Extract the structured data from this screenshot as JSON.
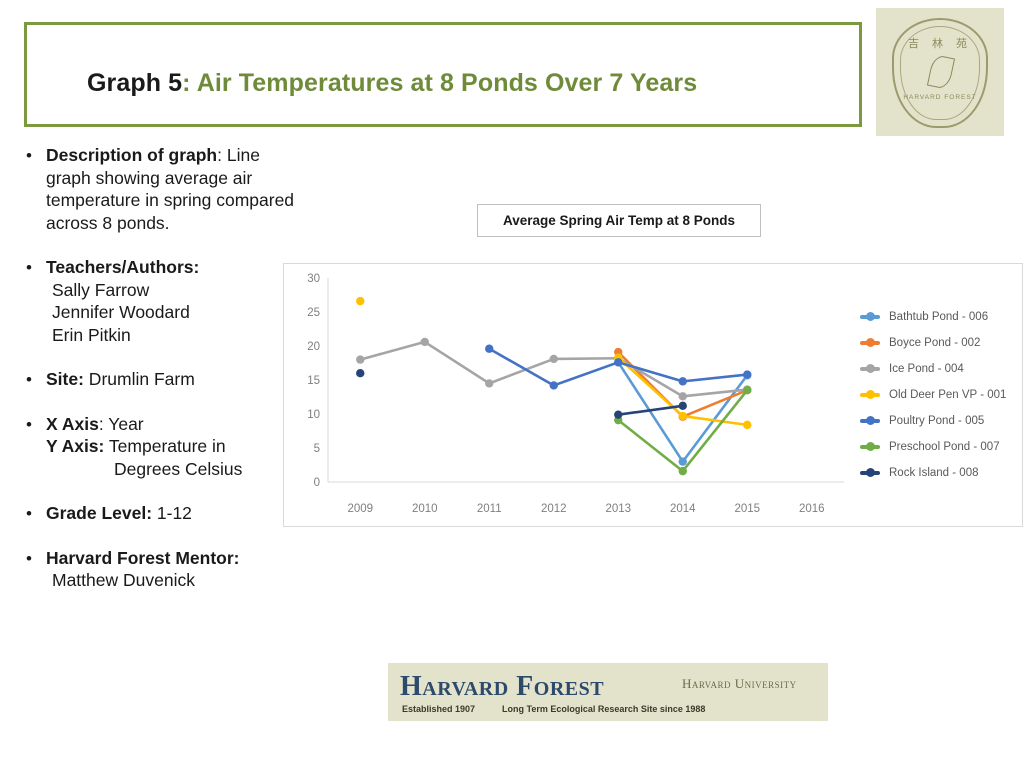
{
  "slide": {
    "title_lead": "Graph 5",
    "title_rest": ": Air Temperatures at 8 Ponds Over 7 Years"
  },
  "seal": {
    "chars": "吉 林 苑",
    "bottom": "HARVARD  FOREST"
  },
  "description": {
    "desc_label": "Description of graph",
    "desc_text": ": Line graph showing average air temperature in spring compared across 8 ponds.",
    "teachers_label": "Teachers/Authors:",
    "teachers": [
      "Sally Farrow",
      "Jennifer Woodard",
      "Erin Pitkin"
    ],
    "site_label": "Site:",
    "site_value": " Drumlin Farm",
    "x_axis_label": "X Axis",
    "x_axis_value": ": Year",
    "y_axis_label": "Y Axis:",
    "y_axis_value": " Temperature  in",
    "y_axis_value2": "Degrees Celsius",
    "grade_label": "Grade Level:",
    "grade_value": "  1-12",
    "mentor_label": "Harvard Forest Mentor:",
    "mentor_value": "Matthew Duvenick"
  },
  "footer": {
    "logo_title": "Harvard Forest",
    "logo_university": "Harvard University",
    "logo_sub_left": "Established 1907",
    "logo_sub_right": "Long Term Ecological Research Site since 1988"
  },
  "chart_data": {
    "type": "line",
    "title": "Average Spring Air Temp at 8 Ponds",
    "xlabel": "",
    "ylabel": "",
    "categories": [
      "2009",
      "2010",
      "2011",
      "2012",
      "2013",
      "2014",
      "2015",
      "2016"
    ],
    "ylim": [
      0,
      30
    ],
    "yticks": [
      0,
      5,
      10,
      15,
      20,
      25,
      30
    ],
    "grid": false,
    "legend_position": "right",
    "series": [
      {
        "name": "Bathtub Pond  - 006",
        "color": "#5b9bd5",
        "values": [
          null,
          null,
          null,
          null,
          17.6,
          3.0,
          15.7,
          null
        ]
      },
      {
        "name": "Boyce Pond - 002",
        "color": "#ed7d31",
        "values": [
          null,
          null,
          null,
          null,
          19.1,
          9.6,
          13.5,
          null
        ]
      },
      {
        "name": "Ice Pond - 004",
        "color": "#a5a5a5",
        "values": [
          18.0,
          20.6,
          14.5,
          18.1,
          18.2,
          12.6,
          13.6,
          null
        ]
      },
      {
        "name": "Old Deer Pen VP - 001",
        "color": "#ffc000",
        "values": [
          26.6,
          null,
          null,
          null,
          18.3,
          9.7,
          8.4,
          null
        ]
      },
      {
        "name": "Poultry Pond - 005",
        "color": "#4472c4",
        "values": [
          null,
          null,
          19.6,
          14.2,
          17.6,
          14.8,
          15.8,
          null
        ]
      },
      {
        "name": "Preschool Pond - 007",
        "color": "#70ad47",
        "values": [
          null,
          null,
          null,
          null,
          9.1,
          1.6,
          13.5,
          null
        ]
      },
      {
        "name": "Rock Island - 008",
        "color": "#264478",
        "values": [
          16.0,
          null,
          null,
          null,
          9.9,
          11.2,
          null,
          null
        ]
      }
    ]
  }
}
